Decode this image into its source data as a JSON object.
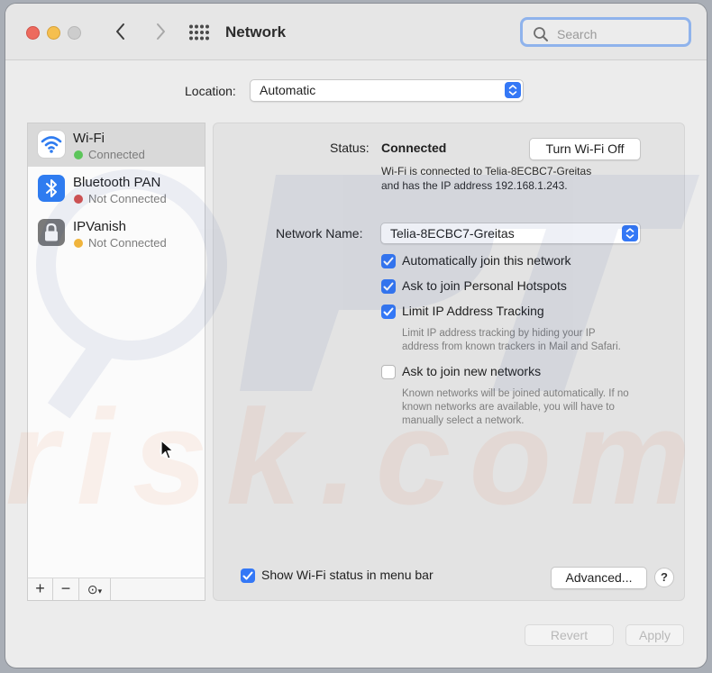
{
  "window": {
    "title": "Network"
  },
  "search": {
    "placeholder": "Search"
  },
  "location": {
    "label": "Location:",
    "value": "Automatic"
  },
  "services": [
    {
      "name": "Wi-Fi",
      "status": "Connected",
      "status_color": "#5cc55a",
      "icon": "wifi-icon",
      "icon_color": "#ffffff",
      "selected": true
    },
    {
      "name": "Bluetooth PAN",
      "status": "Not Connected",
      "status_color": "#d9534f",
      "icon": "bluetooth-icon",
      "icon_color": "#2f7cf0",
      "selected": false
    },
    {
      "name": "IPVanish",
      "status": "Not Connected",
      "status_color": "#f0b43c",
      "icon": "lock-icon",
      "icon_color": "#7a7a7a",
      "selected": false
    }
  ],
  "sidebar_tools": {
    "add": "+",
    "remove": "−",
    "action": "⊙"
  },
  "detail": {
    "status_label": "Status:",
    "status_value": "Connected",
    "turn_off_button": "Turn Wi-Fi Off",
    "status_description_line1": "Wi-Fi is connected to Telia-8ECBC7-Greitas",
    "status_description_line2": "and has the IP address 192.168.1.243.",
    "network_name_label": "Network Name:",
    "network_name_value": "Telia-8ECBC7-Greitas",
    "options": [
      {
        "label": "Automatically join this network",
        "checked": true
      },
      {
        "label": "Ask to join Personal Hotspots",
        "checked": true
      },
      {
        "label": "Limit IP Address Tracking",
        "checked": true
      },
      {
        "label": "Ask to join new networks",
        "checked": false
      }
    ],
    "limit_ip_hint_line1": "Limit IP address tracking by hiding your IP",
    "limit_ip_hint_line2": "address from known trackers in Mail and Safari.",
    "new_networks_hint_line1": "Known networks will be joined automatically. If no",
    "new_networks_hint_line2": "known networks are available, you will have to",
    "new_networks_hint_line3": "manually select a network.",
    "show_status_label": "Show Wi-Fi status in menu bar",
    "show_status_checked": true,
    "advanced_button": "Advanced...",
    "help_button": "?"
  },
  "footer": {
    "revert_button": "Revert",
    "apply_button": "Apply"
  },
  "colors": {
    "accent": "#3478f6",
    "focus_ring": "#8fb3ec"
  }
}
